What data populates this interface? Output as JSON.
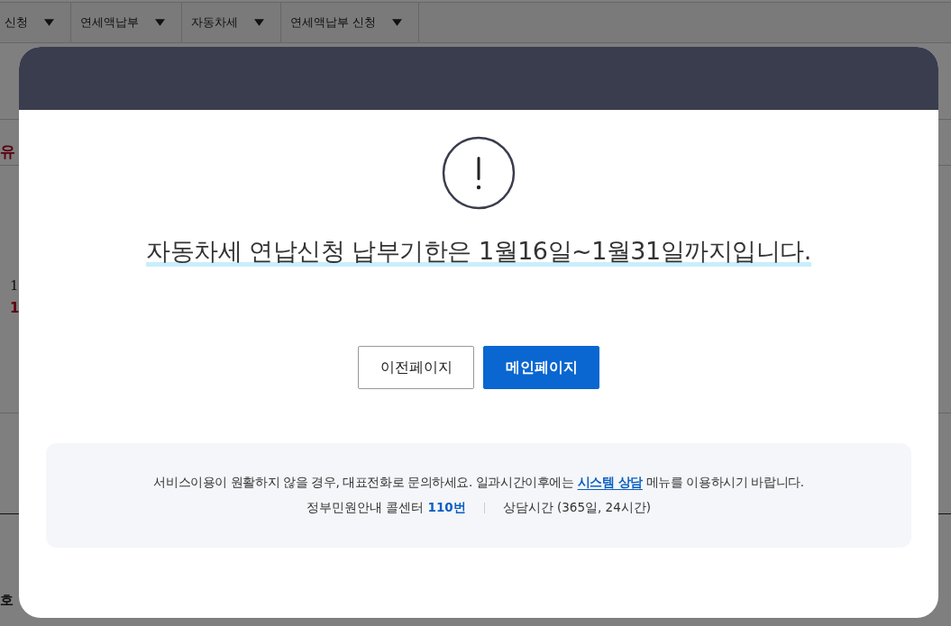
{
  "background_page": {
    "tabs": [
      {
        "label": "신청"
      },
      {
        "label": "연세액납부"
      },
      {
        "label": "자동차세"
      },
      {
        "label": "연세액납부 신청"
      }
    ],
    "fragments": [
      {
        "text": "유",
        "kind": "heading"
      },
      {
        "text": "1",
        "kind": "text"
      },
      {
        "text": "1",
        "kind": "alert"
      },
      {
        "text": "호",
        "kind": "label"
      }
    ]
  },
  "dialog": {
    "message": "자동차세 연납신청 납부기한은 1월16일~1월31일까지입니다.",
    "buttons": [
      {
        "label": "이전페이지",
        "kind": "secondary"
      },
      {
        "label": "메인페이지",
        "kind": "primary"
      }
    ],
    "notice": {
      "text_before": "서비스이용이 원활하지 않을 경우, 대표전화로 문의하세요. 일과시간이후에는 ",
      "link": "시스템 상담",
      "text_after": " 메뉴를 이용하시기 바랍니다.",
      "call_center": "정부민원안내 콜센터 **110번**",
      "hours": "상담시간 (365일, 24시간)"
    }
  }
}
